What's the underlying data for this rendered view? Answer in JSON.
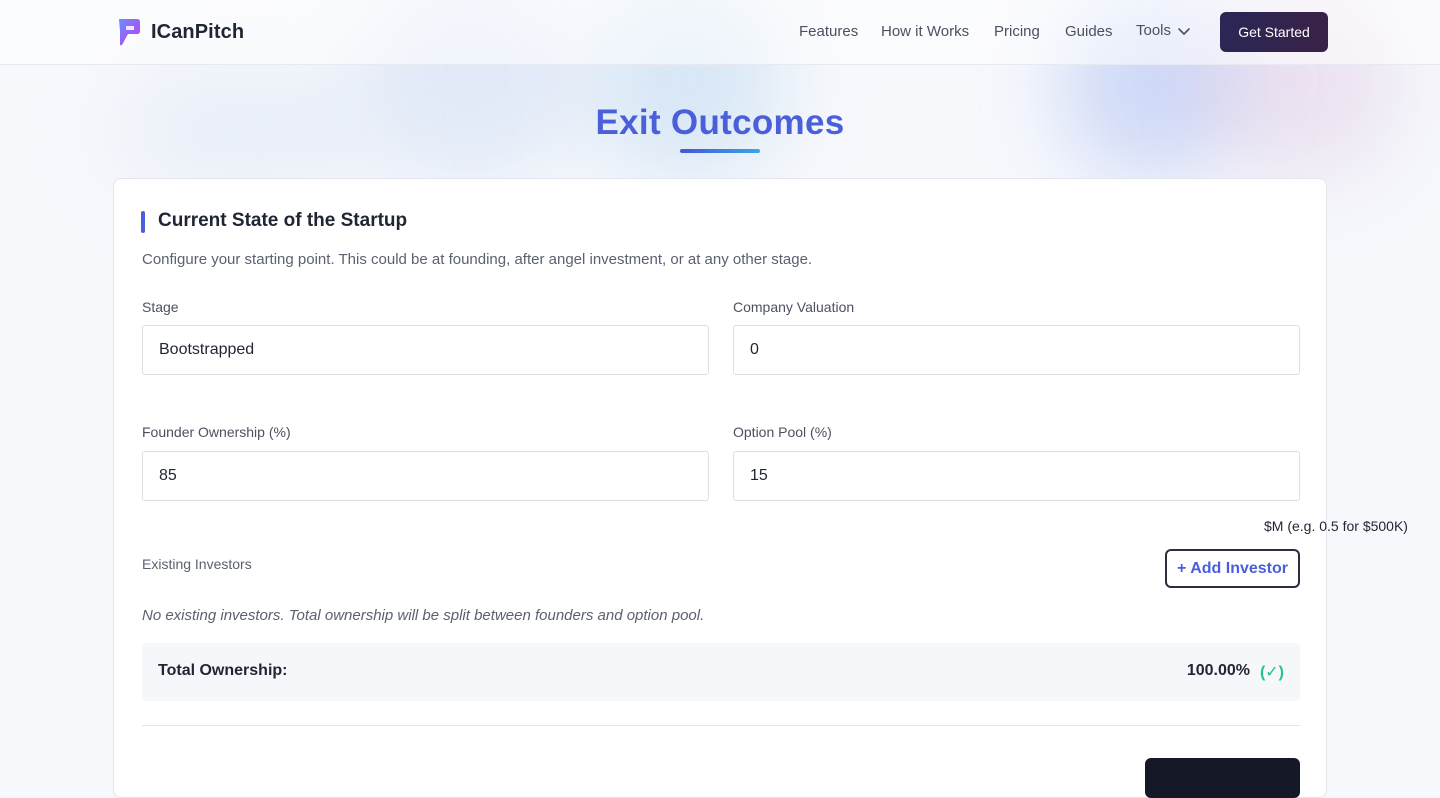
{
  "header": {
    "brand": "ICanPitch",
    "nav": [
      {
        "label": "Features"
      },
      {
        "label": "How it Works"
      },
      {
        "label": "Pricing"
      },
      {
        "label": "Guides"
      },
      {
        "label": "Tools"
      }
    ],
    "cta_label": "Get Started"
  },
  "page": {
    "title": "Exit Outcomes"
  },
  "section": {
    "title": "Current State of the Startup",
    "description": "Configure your starting point. This could be at founding, after angel investment, or at any other stage."
  },
  "fields": {
    "stage": {
      "label": "Stage",
      "value": "Bootstrapped"
    },
    "valuation": {
      "label": "Company Valuation",
      "value": "0",
      "hint": "$M (e.g. 0.5 for $500K)"
    },
    "founder_ownership": {
      "label": "Founder Ownership (%)",
      "value": "85"
    },
    "option_pool": {
      "label": "Option Pool (%)",
      "value": "15"
    }
  },
  "investors": {
    "label": "Existing Investors",
    "add_label": "+ Add Investor",
    "empty_note": "No existing investors. Total ownership will be split between founders and option pool."
  },
  "total": {
    "label": "Total Ownership:",
    "value": "100.00%",
    "status": "(✓)"
  },
  "colors": {
    "accent": "#4a5fd9",
    "success": "#22c58a",
    "cta": "#2a2755"
  }
}
